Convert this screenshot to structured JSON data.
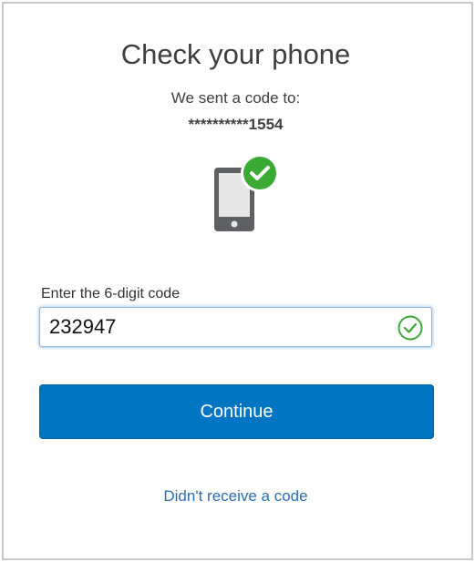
{
  "header": {
    "title": "Check your phone",
    "sent_text": "We sent a code to:",
    "masked_number": "**********1554"
  },
  "icons": {
    "phone": "phone-icon",
    "verified": "check-circle-icon",
    "input_valid": "check-circle-outline-icon"
  },
  "form": {
    "code_label": "Enter the 6-digit code",
    "code_value": "232947",
    "continue_label": "Continue",
    "resend_label": "Didn't receive a code"
  },
  "colors": {
    "primary": "#0075c2",
    "success": "#3aaa35",
    "link": "#2a6eb0"
  }
}
